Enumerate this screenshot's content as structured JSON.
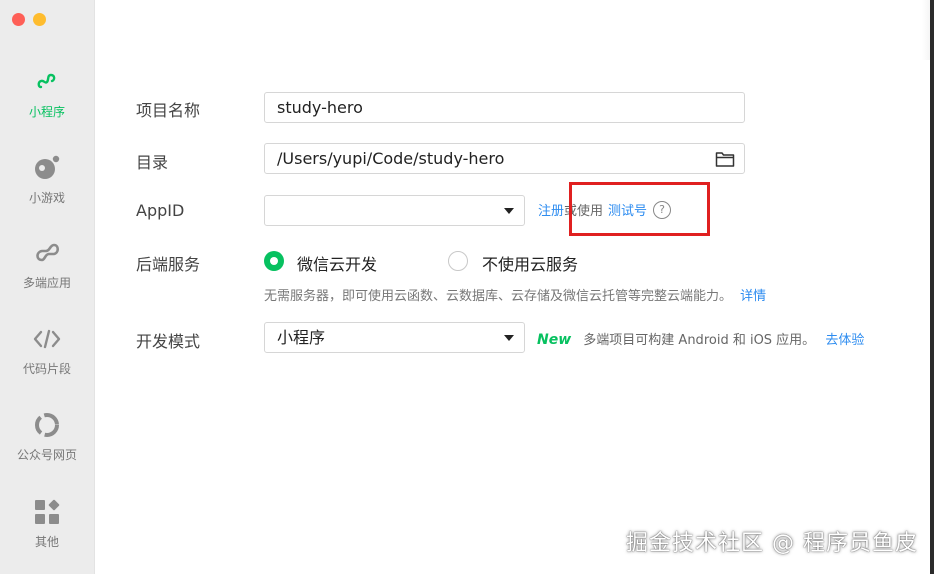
{
  "sidebar": {
    "items": [
      {
        "label": "小程序",
        "icon": "miniprogram-icon",
        "active": true
      },
      {
        "label": "小游戏",
        "icon": "minigame-icon",
        "active": false
      },
      {
        "label": "多端应用",
        "icon": "multiplatform-icon",
        "active": false
      },
      {
        "label": "代码片段",
        "icon": "code-snippet-icon",
        "active": false
      },
      {
        "label": "公众号网页",
        "icon": "official-account-icon",
        "active": false
      },
      {
        "label": "其他",
        "icon": "grid-icon",
        "active": false
      }
    ]
  },
  "form": {
    "project_name": {
      "label": "项目名称",
      "value": "study-hero"
    },
    "directory": {
      "label": "目录",
      "value": "/Users/yupi/Code/study-hero"
    },
    "appid": {
      "label": "AppID",
      "value": "",
      "register_link": "注册",
      "or_text": "或使用",
      "test_link": "测试号",
      "help_icon": "?"
    },
    "backend": {
      "label": "后端服务",
      "option_cloud": "微信云开发",
      "option_none": "不使用云服务",
      "selected": "微信云开发",
      "hint": "无需服务器，即可使用云函数、云数据库、云存储及微信云托管等完整云端能力。",
      "detail_link": "详情"
    },
    "dev_mode": {
      "label": "开发模式",
      "value": "小程序",
      "new_badge": "New",
      "new_text": "多端项目可构建 Android 和 iOS 应用。",
      "try_link": "去体验"
    }
  },
  "watermark": "掘金技术社区 @ 程序员鱼皮",
  "colors": {
    "accent": "#07c160",
    "link": "#2d8cf0",
    "highlight": "#e02020"
  }
}
